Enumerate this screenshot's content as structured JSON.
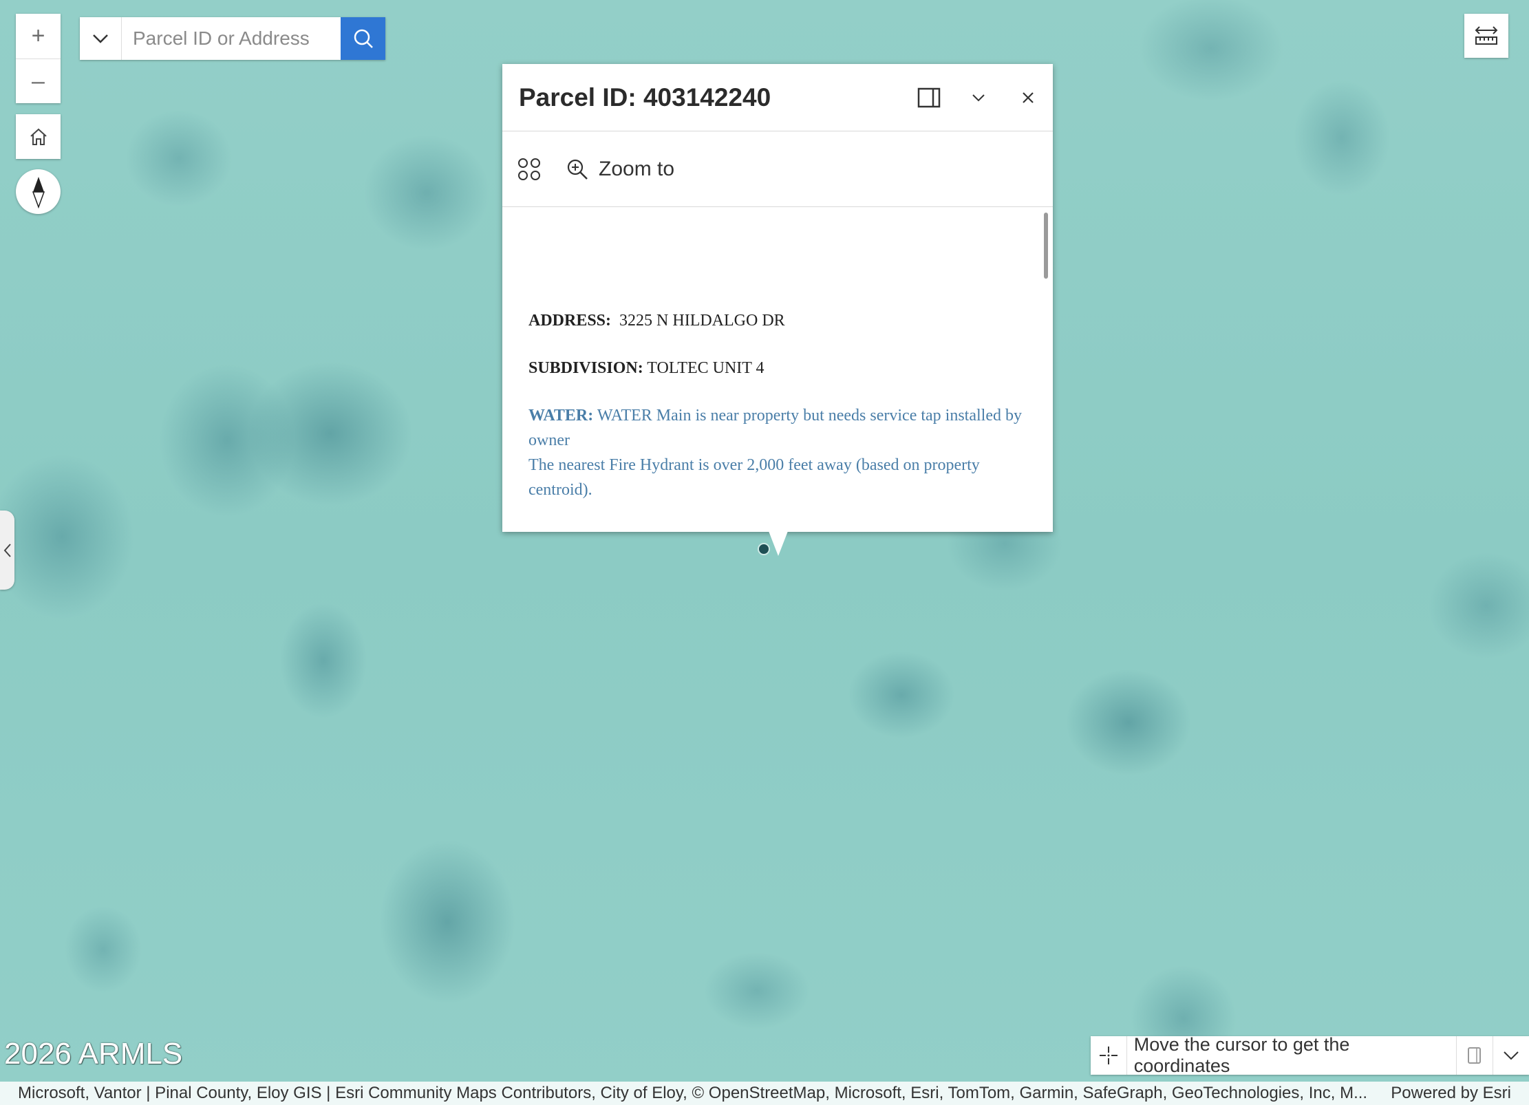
{
  "map": {
    "zoom_in_label": "+",
    "zoom_out_label": "–",
    "watermark": "2026 ARMLS"
  },
  "search": {
    "placeholder": "Parcel ID or Address"
  },
  "popup": {
    "title": "Parcel ID: 403142240",
    "zoom_to_label": "Zoom to",
    "fields": {
      "address_label": "ADDRESS:",
      "address_value": "3225 N HILDALGO DR",
      "subdivision_label": "SUBDIVISION:",
      "subdivision_value": "TOLTEC UNIT 4",
      "water_label": "WATER:",
      "water_value": "WATER Main is near property but needs service tap installed by owner",
      "hydrant_note": "The nearest Fire Hydrant is over 2,000 feet away (based on property centroid)."
    }
  },
  "coordinates": {
    "text": "Move the cursor to get the coordinates"
  },
  "attribution": {
    "text": "Microsoft, Vantor | Pinal County, Eloy GIS | Esri Community Maps Contributors, City of Eloy, © OpenStreetMap, Microsoft, Esri, TomTom, Garmin, SafeGraph, GeoTechnologies, Inc, M...",
    "powered_by": "Powered by Esri"
  },
  "colors": {
    "accent": "#2f77d4",
    "water_text": "#4a7ea8"
  }
}
